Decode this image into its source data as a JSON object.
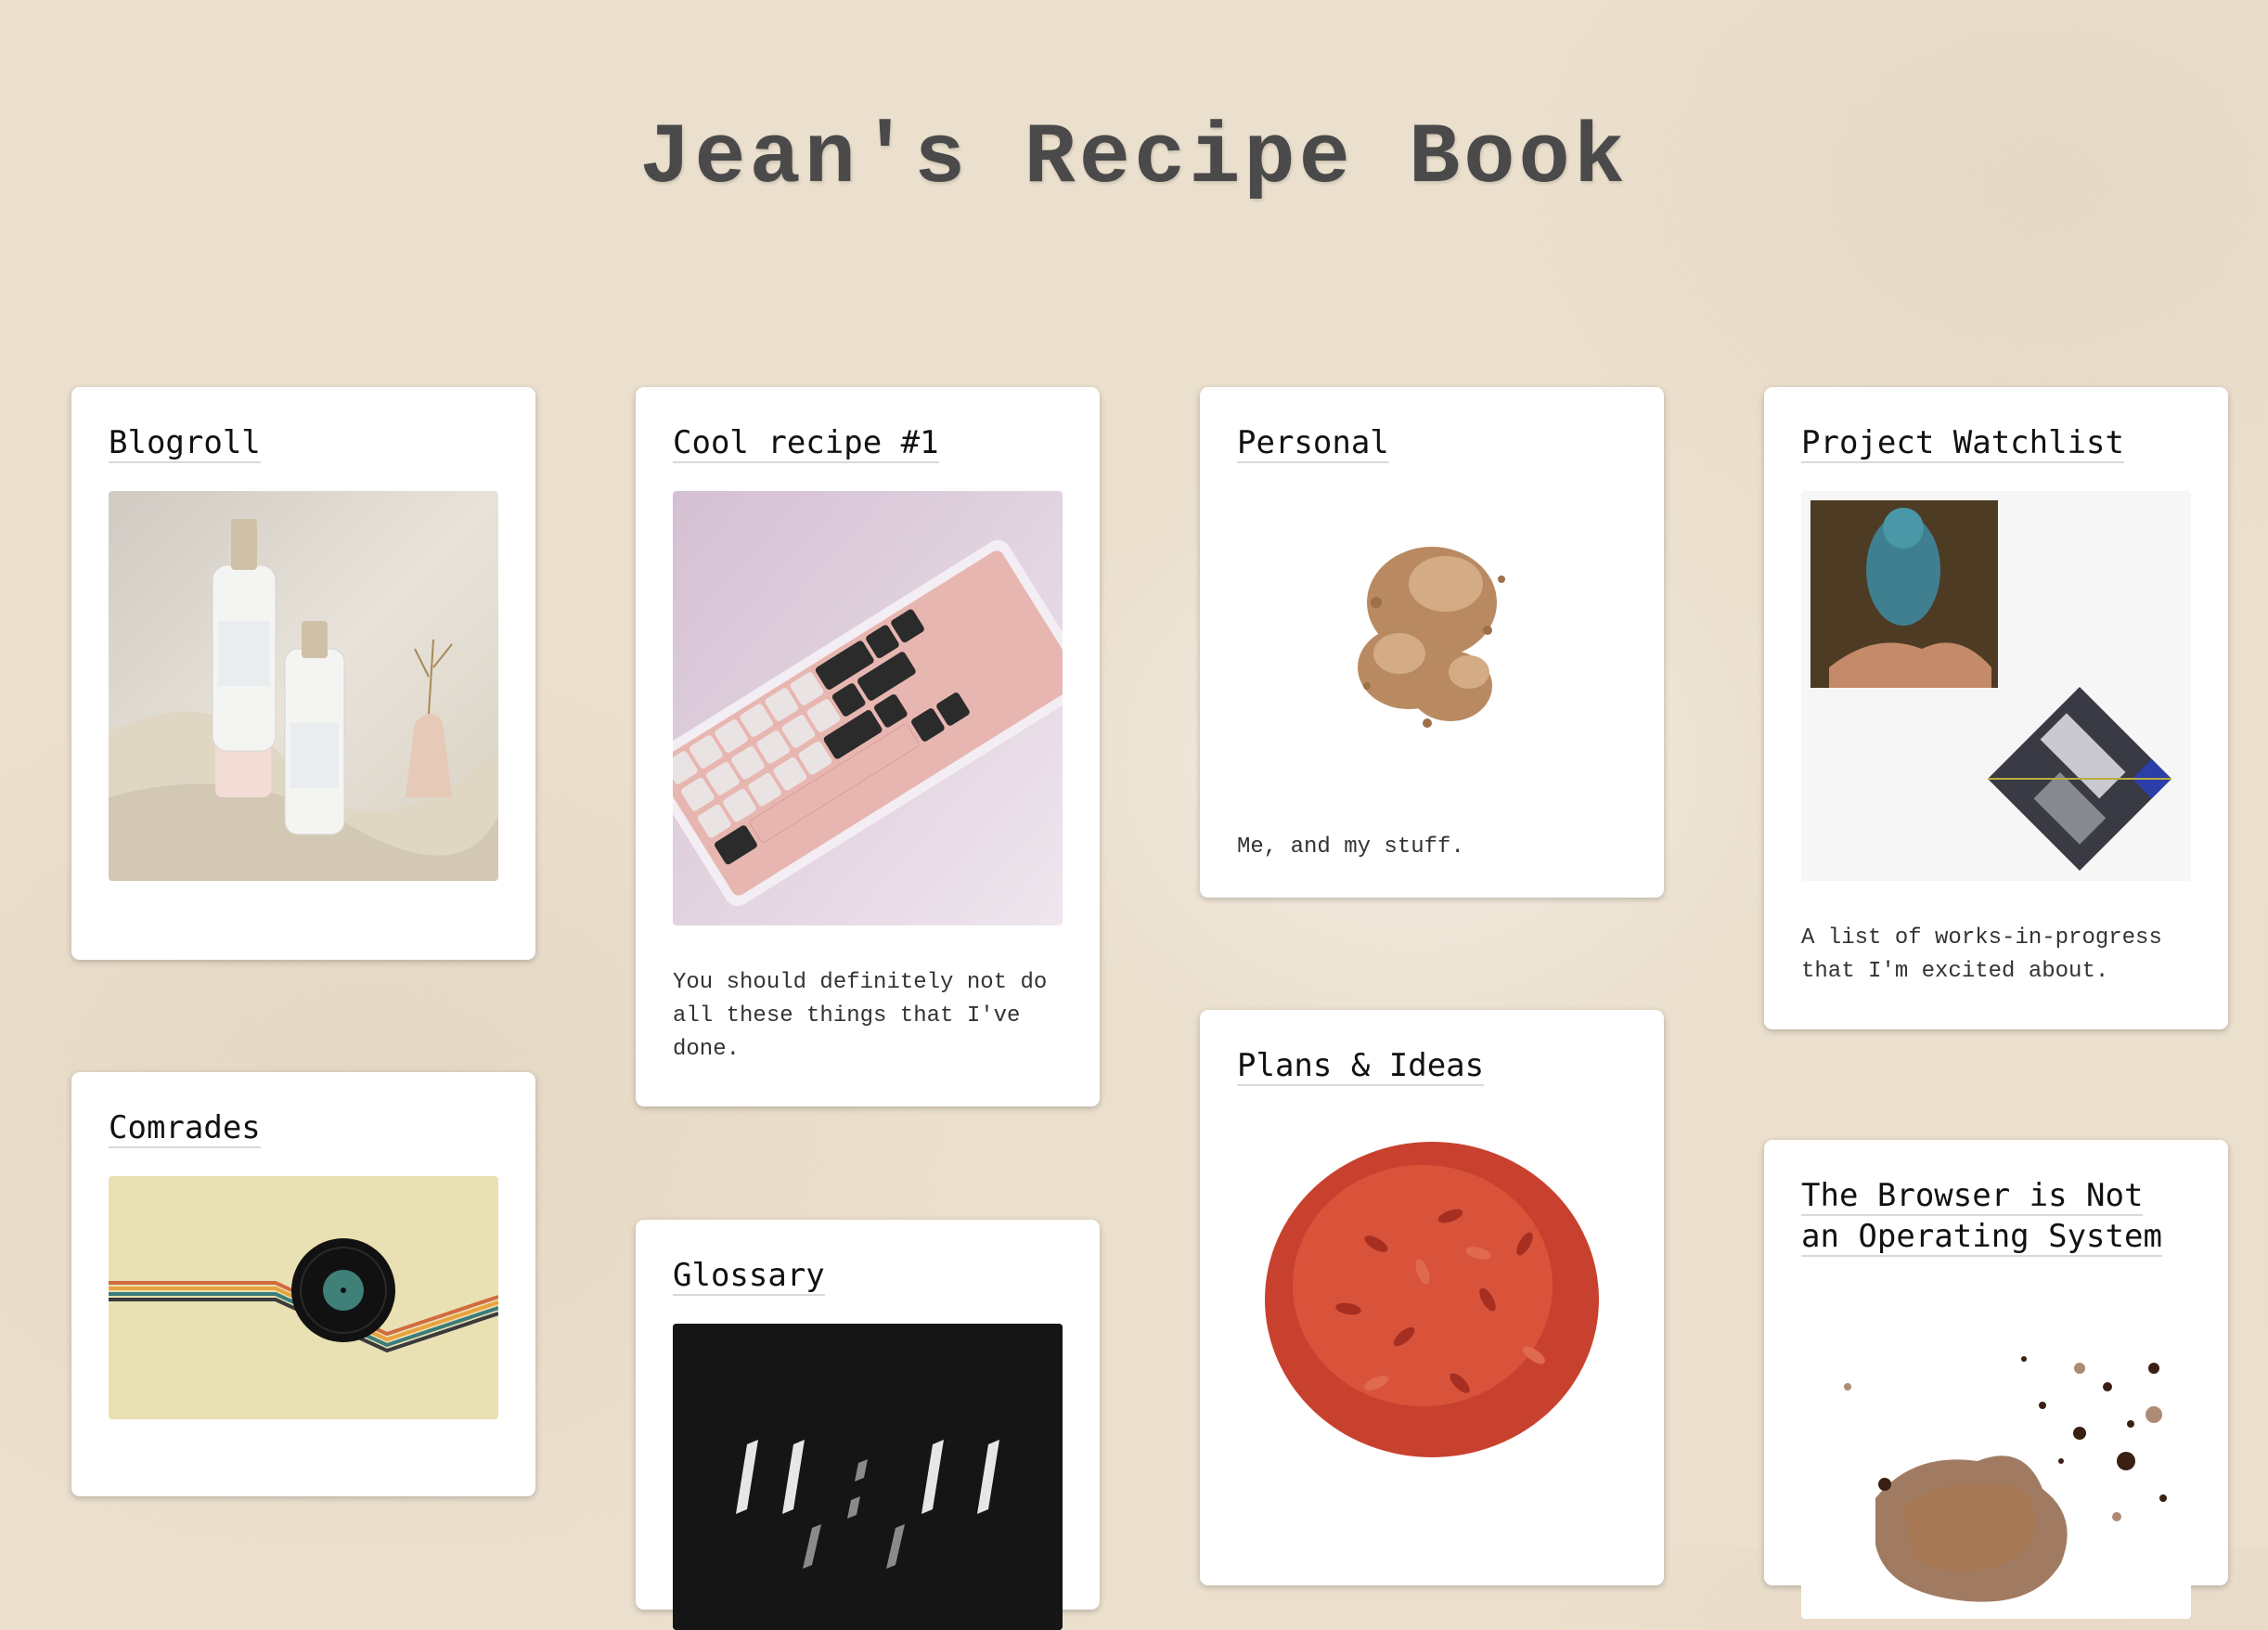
{
  "site": {
    "title": "Jean's Recipe Book"
  },
  "cards": {
    "blogroll": {
      "title": "Blogroll"
    },
    "cool_recipe": {
      "title": "Cool recipe #1",
      "description": "You should definitely not do all these things that I've done."
    },
    "personal": {
      "title": "Personal",
      "description": "Me, and my stuff."
    },
    "project_watchlist": {
      "title": "Project Watchlist",
      "description": "A list of works-in-progress that I'm excited about."
    },
    "comrades": {
      "title": "Comrades"
    },
    "glossary": {
      "title": "Glossary"
    },
    "plans_ideas": {
      "title": "Plans & Ideas"
    },
    "browser_os": {
      "title": "The Browser is Not an Operating System"
    }
  },
  "colors": {
    "background": "#ebdfcd",
    "card": "#ffffff",
    "title_text": "#4a4a4a"
  },
  "icons": {
    "blogroll": "gin-bottles-photo",
    "cool_recipe": "keyboard-photo",
    "personal": "spice-powder-photo",
    "project_watchlist": "collage-photo",
    "comrades": "vinyl-record-illustration",
    "glossary": "digital-clock-photo",
    "plans_ideas": "goji-berries-photo",
    "browser_os": "coffee-stain-photo"
  }
}
